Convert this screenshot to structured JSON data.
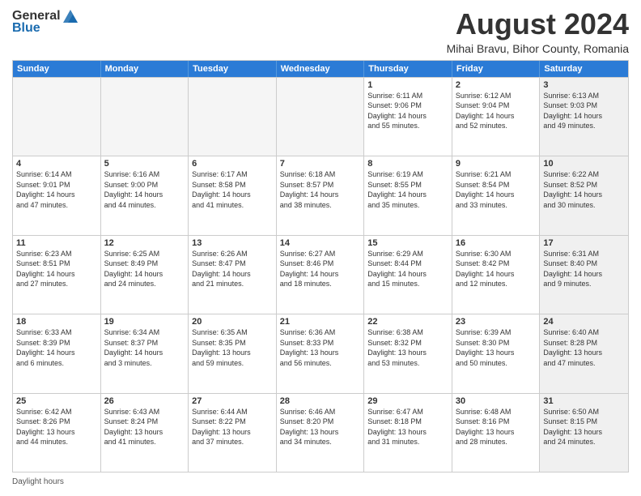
{
  "logo": {
    "general": "General",
    "blue": "Blue"
  },
  "title": "August 2024",
  "subtitle": "Mihai Bravu, Bihor County, Romania",
  "legend": "Daylight hours",
  "days": [
    "Sunday",
    "Monday",
    "Tuesday",
    "Wednesday",
    "Thursday",
    "Friday",
    "Saturday"
  ],
  "rows": [
    [
      {
        "day": "",
        "info": "",
        "empty": true
      },
      {
        "day": "",
        "info": "",
        "empty": true
      },
      {
        "day": "",
        "info": "",
        "empty": true
      },
      {
        "day": "",
        "info": "",
        "empty": true
      },
      {
        "day": "1",
        "info": "Sunrise: 6:11 AM\nSunset: 9:06 PM\nDaylight: 14 hours\nand 55 minutes.",
        "empty": false
      },
      {
        "day": "2",
        "info": "Sunrise: 6:12 AM\nSunset: 9:04 PM\nDaylight: 14 hours\nand 52 minutes.",
        "empty": false
      },
      {
        "day": "3",
        "info": "Sunrise: 6:13 AM\nSunset: 9:03 PM\nDaylight: 14 hours\nand 49 minutes.",
        "empty": false,
        "shaded": true
      }
    ],
    [
      {
        "day": "4",
        "info": "Sunrise: 6:14 AM\nSunset: 9:01 PM\nDaylight: 14 hours\nand 47 minutes.",
        "empty": false
      },
      {
        "day": "5",
        "info": "Sunrise: 6:16 AM\nSunset: 9:00 PM\nDaylight: 14 hours\nand 44 minutes.",
        "empty": false
      },
      {
        "day": "6",
        "info": "Sunrise: 6:17 AM\nSunset: 8:58 PM\nDaylight: 14 hours\nand 41 minutes.",
        "empty": false
      },
      {
        "day": "7",
        "info": "Sunrise: 6:18 AM\nSunset: 8:57 PM\nDaylight: 14 hours\nand 38 minutes.",
        "empty": false
      },
      {
        "day": "8",
        "info": "Sunrise: 6:19 AM\nSunset: 8:55 PM\nDaylight: 14 hours\nand 35 minutes.",
        "empty": false
      },
      {
        "day": "9",
        "info": "Sunrise: 6:21 AM\nSunset: 8:54 PM\nDaylight: 14 hours\nand 33 minutes.",
        "empty": false
      },
      {
        "day": "10",
        "info": "Sunrise: 6:22 AM\nSunset: 8:52 PM\nDaylight: 14 hours\nand 30 minutes.",
        "empty": false,
        "shaded": true
      }
    ],
    [
      {
        "day": "11",
        "info": "Sunrise: 6:23 AM\nSunset: 8:51 PM\nDaylight: 14 hours\nand 27 minutes.",
        "empty": false
      },
      {
        "day": "12",
        "info": "Sunrise: 6:25 AM\nSunset: 8:49 PM\nDaylight: 14 hours\nand 24 minutes.",
        "empty": false
      },
      {
        "day": "13",
        "info": "Sunrise: 6:26 AM\nSunset: 8:47 PM\nDaylight: 14 hours\nand 21 minutes.",
        "empty": false
      },
      {
        "day": "14",
        "info": "Sunrise: 6:27 AM\nSunset: 8:46 PM\nDaylight: 14 hours\nand 18 minutes.",
        "empty": false
      },
      {
        "day": "15",
        "info": "Sunrise: 6:29 AM\nSunset: 8:44 PM\nDaylight: 14 hours\nand 15 minutes.",
        "empty": false
      },
      {
        "day": "16",
        "info": "Sunrise: 6:30 AM\nSunset: 8:42 PM\nDaylight: 14 hours\nand 12 minutes.",
        "empty": false
      },
      {
        "day": "17",
        "info": "Sunrise: 6:31 AM\nSunset: 8:40 PM\nDaylight: 14 hours\nand 9 minutes.",
        "empty": false,
        "shaded": true
      }
    ],
    [
      {
        "day": "18",
        "info": "Sunrise: 6:33 AM\nSunset: 8:39 PM\nDaylight: 14 hours\nand 6 minutes.",
        "empty": false
      },
      {
        "day": "19",
        "info": "Sunrise: 6:34 AM\nSunset: 8:37 PM\nDaylight: 14 hours\nand 3 minutes.",
        "empty": false
      },
      {
        "day": "20",
        "info": "Sunrise: 6:35 AM\nSunset: 8:35 PM\nDaylight: 13 hours\nand 59 minutes.",
        "empty": false
      },
      {
        "day": "21",
        "info": "Sunrise: 6:36 AM\nSunset: 8:33 PM\nDaylight: 13 hours\nand 56 minutes.",
        "empty": false
      },
      {
        "day": "22",
        "info": "Sunrise: 6:38 AM\nSunset: 8:32 PM\nDaylight: 13 hours\nand 53 minutes.",
        "empty": false
      },
      {
        "day": "23",
        "info": "Sunrise: 6:39 AM\nSunset: 8:30 PM\nDaylight: 13 hours\nand 50 minutes.",
        "empty": false
      },
      {
        "day": "24",
        "info": "Sunrise: 6:40 AM\nSunset: 8:28 PM\nDaylight: 13 hours\nand 47 minutes.",
        "empty": false,
        "shaded": true
      }
    ],
    [
      {
        "day": "25",
        "info": "Sunrise: 6:42 AM\nSunset: 8:26 PM\nDaylight: 13 hours\nand 44 minutes.",
        "empty": false
      },
      {
        "day": "26",
        "info": "Sunrise: 6:43 AM\nSunset: 8:24 PM\nDaylight: 13 hours\nand 41 minutes.",
        "empty": false
      },
      {
        "day": "27",
        "info": "Sunrise: 6:44 AM\nSunset: 8:22 PM\nDaylight: 13 hours\nand 37 minutes.",
        "empty": false
      },
      {
        "day": "28",
        "info": "Sunrise: 6:46 AM\nSunset: 8:20 PM\nDaylight: 13 hours\nand 34 minutes.",
        "empty": false
      },
      {
        "day": "29",
        "info": "Sunrise: 6:47 AM\nSunset: 8:18 PM\nDaylight: 13 hours\nand 31 minutes.",
        "empty": false
      },
      {
        "day": "30",
        "info": "Sunrise: 6:48 AM\nSunset: 8:16 PM\nDaylight: 13 hours\nand 28 minutes.",
        "empty": false
      },
      {
        "day": "31",
        "info": "Sunrise: 6:50 AM\nSunset: 8:15 PM\nDaylight: 13 hours\nand 24 minutes.",
        "empty": false,
        "shaded": true
      }
    ]
  ]
}
